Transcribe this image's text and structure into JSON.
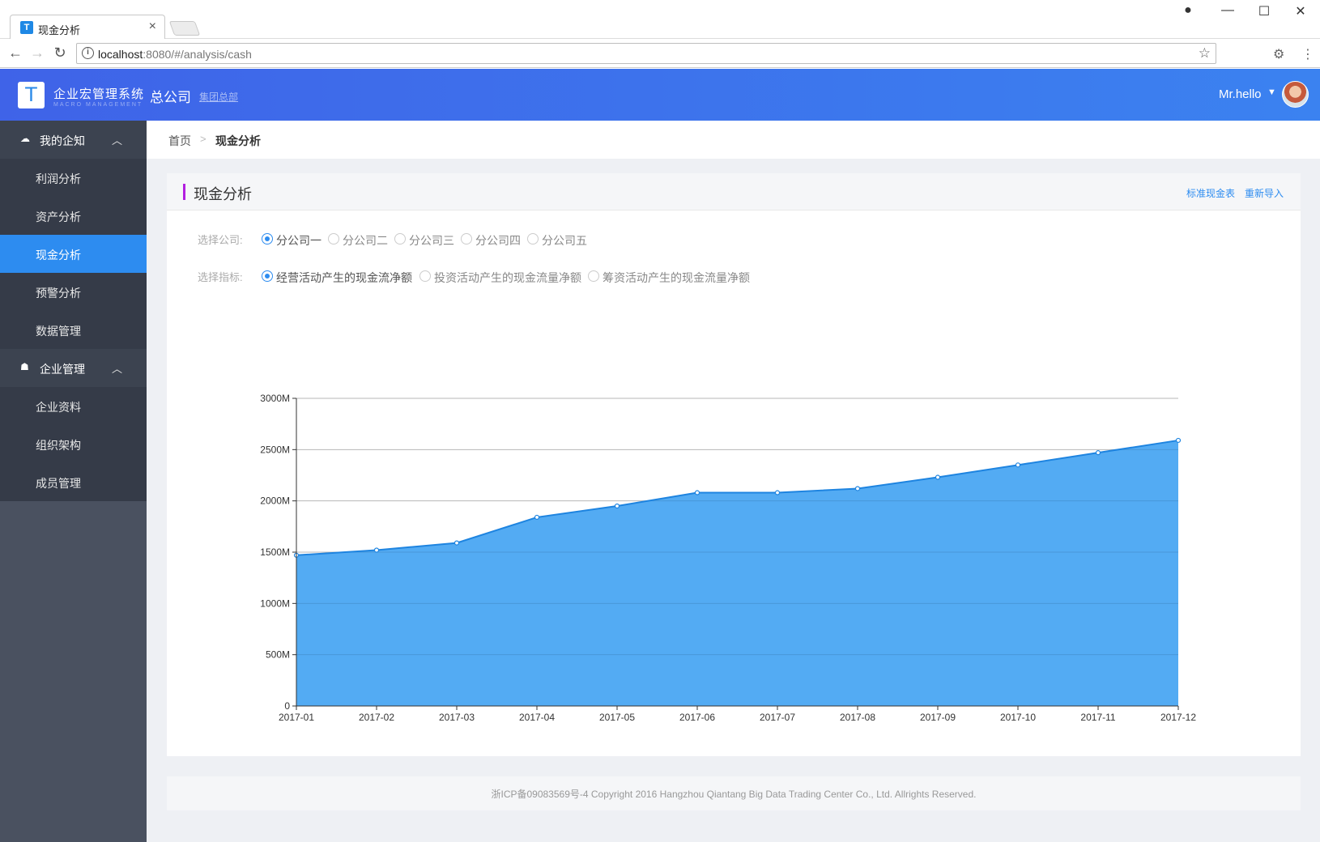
{
  "browser": {
    "tab_title": "现金分析",
    "tab_favicon": "T",
    "url_host": "localhost",
    "url_rest": ":8080/#/analysis/cash"
  },
  "header": {
    "logo_letter": "T",
    "app_title": "企业宏管理系统",
    "app_subtitle": "MACRO MANAGEMENT",
    "company": "总公司",
    "company_link": "集团总部",
    "user": "Mr.hello"
  },
  "sidebar": {
    "groups": [
      {
        "label": "我的企知",
        "icon": "cloud-icon",
        "items": [
          {
            "label": "利润分析",
            "active": false
          },
          {
            "label": "资产分析",
            "active": false
          },
          {
            "label": "现金分析",
            "active": true
          },
          {
            "label": "预警分析",
            "active": false
          },
          {
            "label": "数据管理",
            "active": false
          }
        ]
      },
      {
        "label": "企业管理",
        "icon": "team-icon",
        "items": [
          {
            "label": "企业资料",
            "active": false
          },
          {
            "label": "组织架构",
            "active": false
          },
          {
            "label": "成员管理",
            "active": false
          }
        ]
      }
    ]
  },
  "breadcrumb": {
    "home": "首页",
    "sep": ">",
    "current": "现金分析"
  },
  "card": {
    "title": "现金分析",
    "link_standard": "标准现金表",
    "link_reimport": "重新导入"
  },
  "filters": {
    "company_label": "选择公司:",
    "companies": [
      "分公司一",
      "分公司二",
      "分公司三",
      "分公司四",
      "分公司五"
    ],
    "company_selected": 0,
    "indicator_label": "选择指标:",
    "indicators": [
      "经营活动产生的现金流净额",
      "投资活动产生的现金流量净额",
      "筹资活动产生的现金流量净额"
    ],
    "indicator_selected": 0
  },
  "chart_data": {
    "type": "area",
    "x": [
      "2017-01",
      "2017-02",
      "2017-03",
      "2017-04",
      "2017-05",
      "2017-06",
      "2017-07",
      "2017-08",
      "2017-09",
      "2017-10",
      "2017-11",
      "2017-12"
    ],
    "series": [
      {
        "values": [
          1470,
          1520,
          1590,
          1840,
          1950,
          2080,
          2080,
          2120,
          2230,
          2350,
          2470,
          2590
        ]
      }
    ],
    "yticks": [
      "0",
      "500M",
      "1000M",
      "1500M",
      "2000M",
      "2500M",
      "3000M"
    ],
    "ylim": [
      0,
      3000
    ],
    "grid": true,
    "color": "#4aa7f2",
    "line_color": "#1e84e0"
  },
  "footer": {
    "text": "浙ICP备09083569号-4 Copyright 2016 Hangzhou Qiantang Big Data Trading Center Co., Ltd. Allrights Reserved."
  }
}
